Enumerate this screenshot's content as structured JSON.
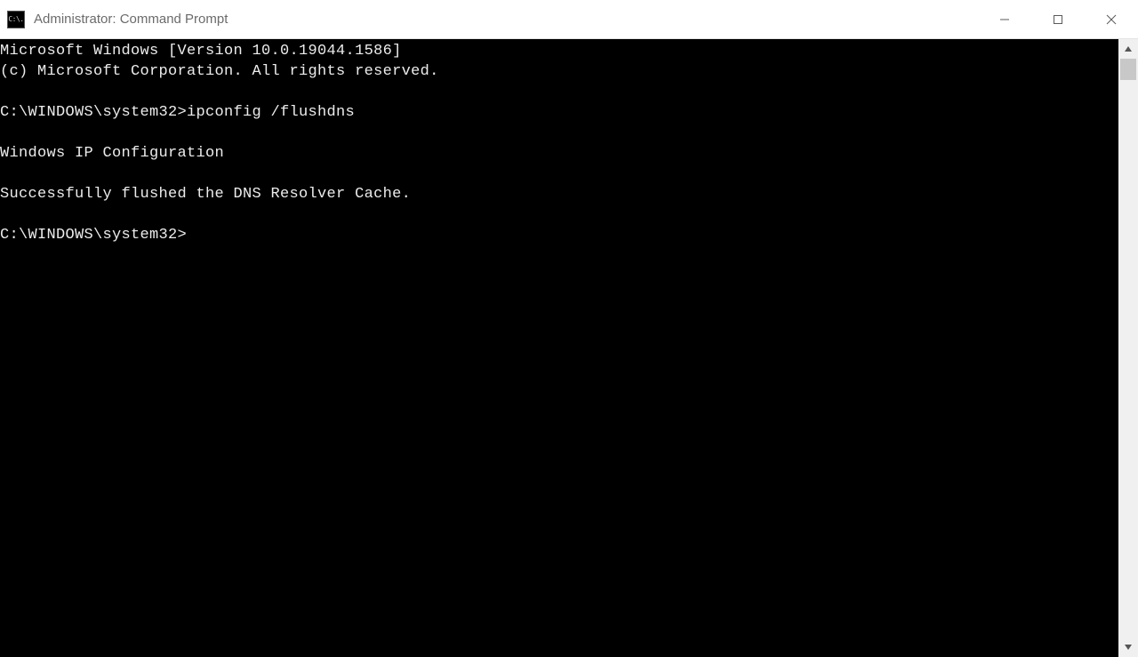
{
  "window": {
    "title": "Administrator: Command Prompt",
    "icon_text": "C:\\."
  },
  "terminal": {
    "lines": [
      "Microsoft Windows [Version 10.0.19044.1586]",
      "(c) Microsoft Corporation. All rights reserved.",
      "",
      "C:\\WINDOWS\\system32>ipconfig /flushdns",
      "",
      "Windows IP Configuration",
      "",
      "Successfully flushed the DNS Resolver Cache.",
      "",
      "C:\\WINDOWS\\system32>"
    ]
  }
}
